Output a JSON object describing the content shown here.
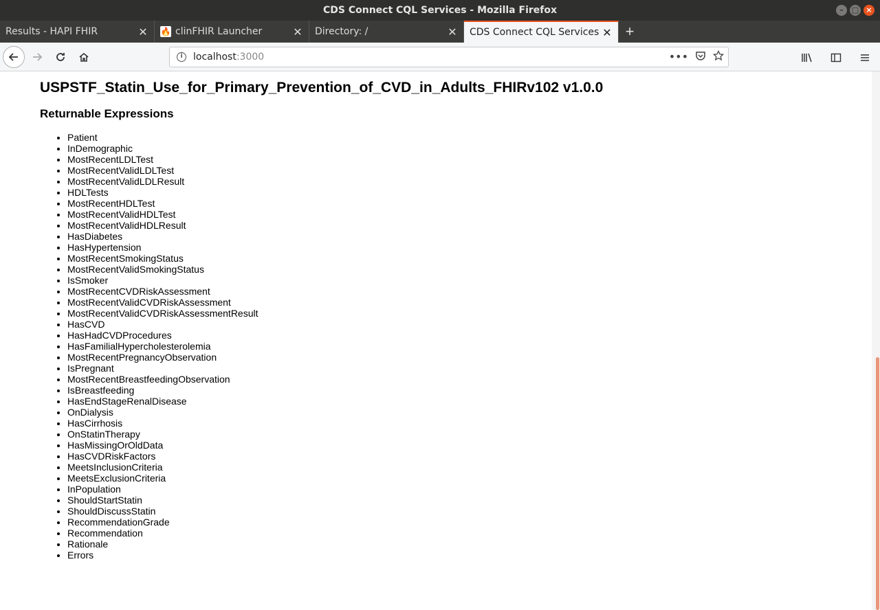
{
  "window": {
    "title": "CDS Connect CQL Services - Mozilla Firefox"
  },
  "tabs": [
    {
      "label": "Results - HAPI FHIR",
      "active": false,
      "favicon": ""
    },
    {
      "label": "clinFHIR Launcher",
      "active": false,
      "favicon": "flame-icon"
    },
    {
      "label": "Directory: /",
      "active": false,
      "favicon": ""
    },
    {
      "label": "CDS Connect CQL Services",
      "active": true,
      "favicon": ""
    }
  ],
  "urlbar": {
    "host": "localhost",
    "port": ":3000"
  },
  "page": {
    "heading": "USPSTF_Statin_Use_for_Primary_Prevention_of_CVD_in_Adults_FHIRv102 v1.0.0",
    "subheading": "Returnable Expressions",
    "expressions": [
      "Patient",
      "InDemographic",
      "MostRecentLDLTest",
      "MostRecentValidLDLTest",
      "MostRecentValidLDLResult",
      "HDLTests",
      "MostRecentHDLTest",
      "MostRecentValidHDLTest",
      "MostRecentValidHDLResult",
      "HasDiabetes",
      "HasHypertension",
      "MostRecentSmokingStatus",
      "MostRecentValidSmokingStatus",
      "IsSmoker",
      "MostRecentCVDRiskAssessment",
      "MostRecentValidCVDRiskAssessment",
      "MostRecentValidCVDRiskAssessmentResult",
      "HasCVD",
      "HasHadCVDProcedures",
      "HasFamilialHypercholesterolemia",
      "MostRecentPregnancyObservation",
      "IsPregnant",
      "MostRecentBreastfeedingObservation",
      "IsBreastfeeding",
      "HasEndStageRenalDisease",
      "OnDialysis",
      "HasCirrhosis",
      "OnStatinTherapy",
      "HasMissingOrOldData",
      "HasCVDRiskFactors",
      "MeetsInclusionCriteria",
      "MeetsExclusionCriteria",
      "InPopulation",
      "ShouldStartStatin",
      "ShouldDiscussStatin",
      "RecommendationGrade",
      "Recommendation",
      "Rationale",
      "Errors"
    ]
  },
  "colors": {
    "accent": "#e95420",
    "scroll_thumb": "#e9967a"
  }
}
